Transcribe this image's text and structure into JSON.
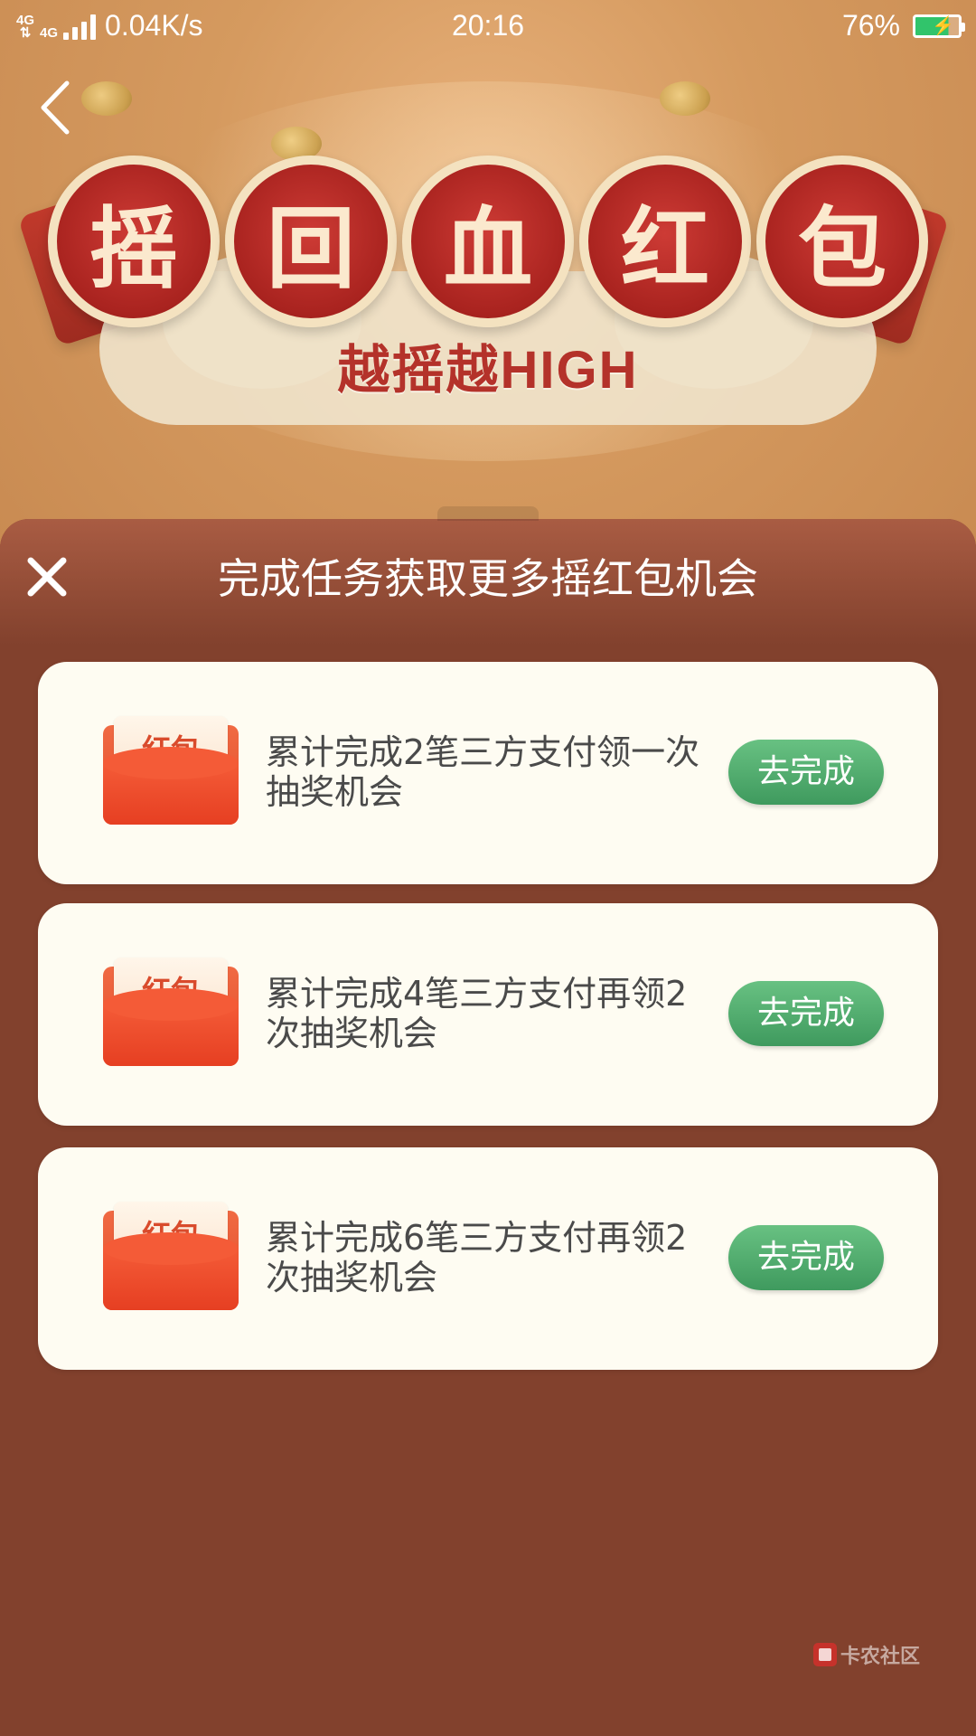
{
  "status_bar": {
    "network_label_1": "4G",
    "network_label_2": "4G",
    "speed": "0.04K/s",
    "time": "20:16",
    "battery_percent": "76%",
    "battery_level": 0.76
  },
  "banner": {
    "title_chars": [
      "摇",
      "回",
      "血",
      "红",
      "包"
    ],
    "slogan": "越摇越HIGH"
  },
  "sheet": {
    "title": "完成任务获取更多摇红包机会",
    "tasks": [
      {
        "badge": "红包",
        "text": "累计完成2笔三方支付领一次抽奖机会",
        "button": "去完成"
      },
      {
        "badge": "红包",
        "text": "累计完成4笔三方支付再领2次抽奖机会",
        "button": "去完成"
      },
      {
        "badge": "红包",
        "text": "累计完成6笔三方支付再领2次抽奖机会",
        "button": "去完成"
      }
    ]
  },
  "watermark": {
    "text": "卡农社区"
  },
  "colors": {
    "sheet_bg": "#82412d",
    "card_bg": "#fefcf2",
    "button_green": "#4fae6d",
    "badge_red": "#a9231f"
  }
}
